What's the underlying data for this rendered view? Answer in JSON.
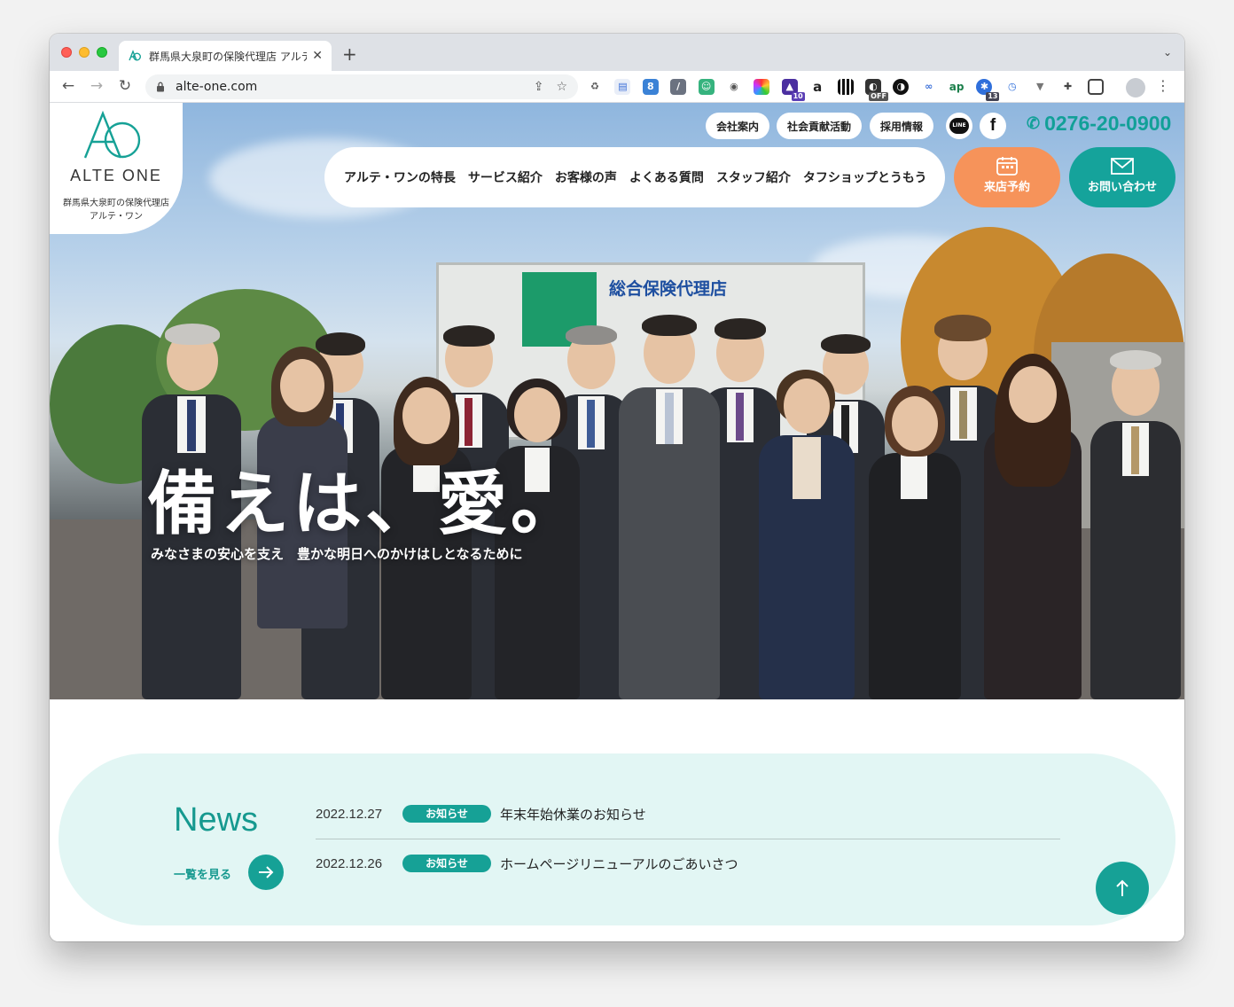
{
  "browser": {
    "tab_title": "群馬県大泉町の保険代理店 アルテ",
    "url": "alte-one.com",
    "extension_badges": {
      "ext_5": "10",
      "ext_11": "OFF",
      "ext_15": "13"
    }
  },
  "site": {
    "logo_text": "ALTE ONE",
    "logo_sub1": "群馬県大泉町の保険代理店",
    "logo_sub2": "アルテ・ワン",
    "util_links": [
      "会社案内",
      "社会貢献活動",
      "採用情報"
    ],
    "line_label": "LINE",
    "phone": "0276-20-0900",
    "nav": [
      "アルテ・ワンの特長",
      "サービス紹介",
      "お客様の声",
      "よくある質問",
      "スタッフ紹介",
      "タフショップとうもう"
    ],
    "cta_reserve": "来店予約",
    "cta_contact": "お問い合わせ",
    "colors": {
      "brand_teal": "#16a196",
      "cta_orange": "#f6935a"
    }
  },
  "hero": {
    "sign_text": "総合保険代理店",
    "catchphrase": "備えは、愛。",
    "subtitle": "みなさまの安心を支え　豊かな明日へのかけはしとなるために"
  },
  "news": {
    "title": "News",
    "more_label": "一覧を見る",
    "items": [
      {
        "date": "2022.12.27",
        "tag": "お知らせ",
        "text": "年末年始休業のお知らせ"
      },
      {
        "date": "2022.12.26",
        "tag": "お知らせ",
        "text": "ホームページリニューアルのごあいさつ"
      }
    ]
  }
}
